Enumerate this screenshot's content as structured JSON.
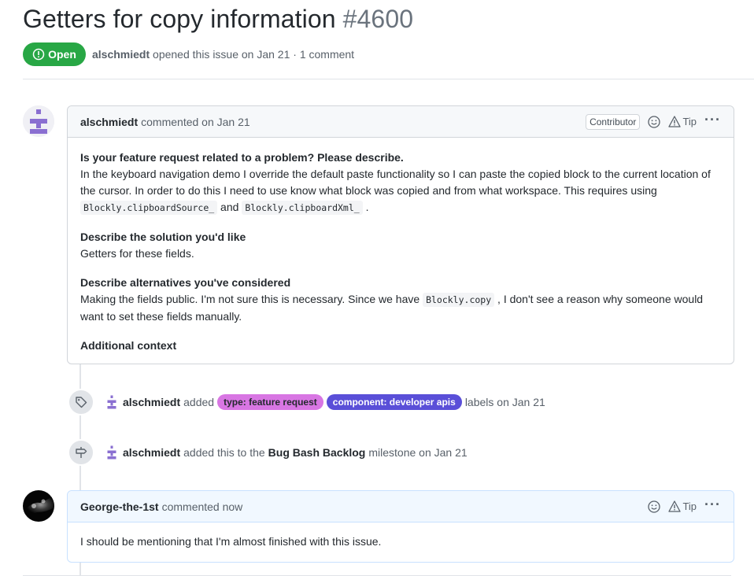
{
  "issue": {
    "title": "Getters for copy information",
    "number": "#4600",
    "state": "Open",
    "author": "alschmiedt",
    "meta_text": "opened this issue on Jan 21 · 1 comment"
  },
  "comment1": {
    "author": "alschmiedt",
    "time": "commented on Jan 21",
    "role_badge": "Contributor",
    "tip": "Tip",
    "q1_heading": "Is your feature request related to a problem? Please describe.",
    "q1_text_a": "In the keyboard navigation demo I override the default paste functionality so I can paste the copied block to the current location of the cursor. In order to do this I need to use know what block was copied and from what workspace. This requires using ",
    "code1": "Blockly.clipboardSource_",
    "q1_text_and": " and ",
    "code2": "Blockly.clipboardXml_",
    "q1_text_end": " .",
    "q2_heading": "Describe the solution you'd like",
    "q2_text": "Getters for these fields.",
    "q3_heading": "Describe alternatives you've considered",
    "q3_text_a": "Making the fields public. I'm not sure this is necessary. Since we have ",
    "code3": "Blockly.copy",
    "q3_text_b": " , I don't see a reason why someone would want to set these fields manually.",
    "q4_heading": "Additional context"
  },
  "events": [
    {
      "actor": "alschmiedt",
      "verb": "added",
      "labels": [
        {
          "name": "type: feature request",
          "bg": "#d876e3",
          "fg": "#24292e"
        },
        {
          "name": "component: developer apis",
          "bg": "#5a4fd8",
          "fg": "#ffffff"
        }
      ],
      "suffix": "labels on Jan 21"
    },
    {
      "actor": "alschmiedt",
      "verb": "added this to the",
      "milestone": "Bug Bash Backlog",
      "suffix": "milestone on Jan 21"
    }
  ],
  "comment2": {
    "author": "George-the-1st",
    "time": "commented now",
    "tip": "Tip",
    "body": "I should be mentioning that I'm almost finished with this issue."
  },
  "colors": {
    "open_green": "#28a745",
    "identicon": "#8a6fd1",
    "border": "#d1d5da"
  },
  "icons": [
    "issue-opened-icon",
    "smiley-icon",
    "alert-icon",
    "kebab-horizontal-icon",
    "tag-icon",
    "milestone-icon"
  ]
}
